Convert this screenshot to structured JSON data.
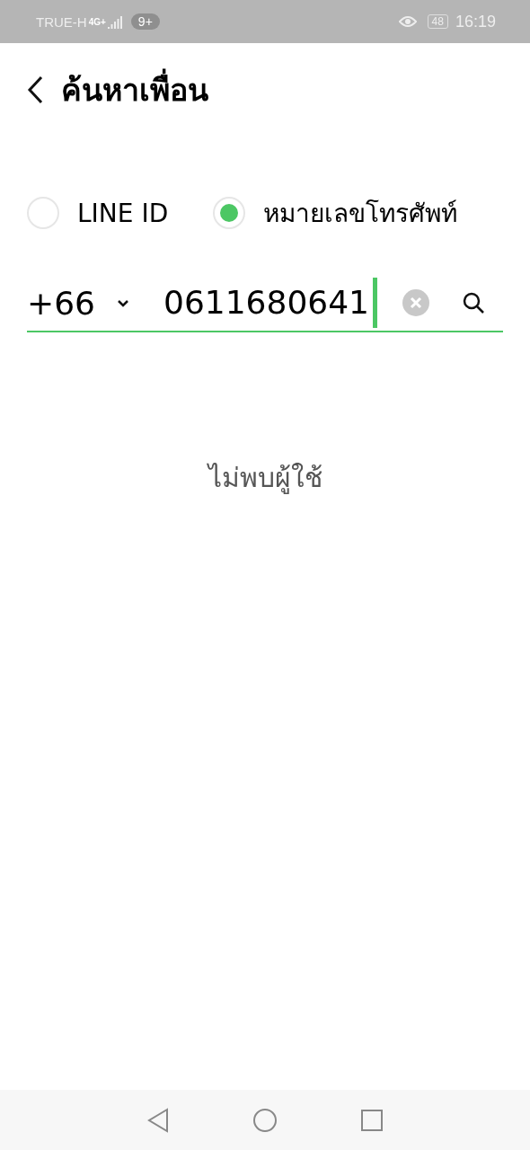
{
  "status_bar": {
    "carrier": "TRUE-H",
    "network": "4G+",
    "notification_count": "9+",
    "battery": "48",
    "time": "16:19"
  },
  "header": {
    "title": "ค้นหาเพื่อน"
  },
  "search_type": [
    {
      "label": "LINE ID",
      "selected": false
    },
    {
      "label": "หมายเลขโทรศัพท์",
      "selected": true
    }
  ],
  "phone_field": {
    "country_code": "+66",
    "value": "0611680641"
  },
  "message": "ไม่พบผู้ใช้"
}
